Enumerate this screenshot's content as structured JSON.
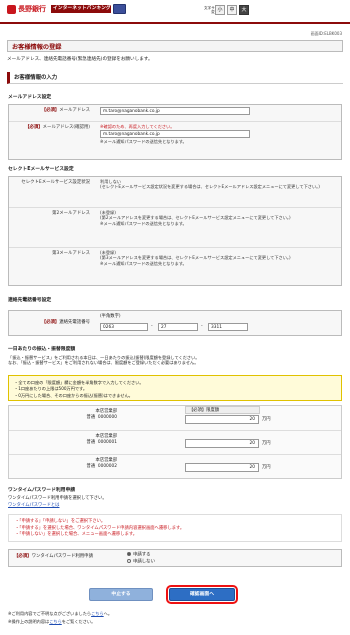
{
  "header": {
    "bank_name": "長野銀行",
    "service_badge": "インターネットバンキング",
    "font_size_label": "文字サイズを\n変更する",
    "font_sizes": [
      "小",
      "中",
      "大"
    ]
  },
  "screen_id": "画面ID:ELBK003",
  "title": "お客様情報の登録",
  "intro": "メールアドレス、連絡先電話番号(緊急連絡先)の登録をお願いします。",
  "section_title": "お客様情報の入力",
  "email_section": {
    "title": "メールアドレス設定",
    "rows": [
      {
        "required": "【必須】",
        "label": "メールアドレス",
        "value": "m.taro@naganobank.co.jp"
      },
      {
        "required": "【必須】",
        "label": "メールアドレス(確認用)",
        "warning": "※確認のため、再度入力してください。",
        "value": "m.taro@naganobank.co.jp",
        "note": "※メール通知パスワードの送信先となります。"
      }
    ]
  },
  "select_section": {
    "title": "セレクトEメールサービス設定",
    "rows": [
      {
        "label": "セレクトEメールサービス設定状況",
        "value": "利用しない",
        "note": "(セレクトEメールサービス設定状況を変更する場合は、セレクトEメールアドレス設定メニューにて変更して下さい。)"
      },
      {
        "label": "第2メールアドレス",
        "value": "(未登録)",
        "note": "(第2メールアドレスを変更する場合は、セレクトEメールサービス設定メニューにて変更して下さい。)",
        "note2": "※メール通知パスワードの送信先となります。"
      },
      {
        "label": "第3メールアドレス",
        "value": "(未登録)",
        "note": "(第3メールアドレスを変更する場合は、セレクトEメールサービス設定メニューにて変更して下さい。)",
        "note2": "※メール通知パスワードの送信先となります。"
      }
    ]
  },
  "phone_section": {
    "title": "連絡先電話番号設定",
    "required": "【必須】",
    "label": "連絡先電話番号",
    "hint": "(半角数字)",
    "parts": [
      "0263",
      "27",
      "3311"
    ],
    "separator": "-"
  },
  "limit_section": {
    "title": "一日あたりの振込・振替限度額",
    "desc1": "「振込・振替サービス」をご利用される本日は、一日あたりの振込(振替)限度額を登録してください。",
    "desc2": "なお、「振込・振替サービス」をご利用されない場合は、限度額をご登録いただく必要はありません。",
    "notices": [
      "・全ての口座の「限度額」欄に金額を半角数字で入力してください。",
      "・1口座あたりの上限は500万円です。",
      "・0万円にした場合、その口座からの振込(振替)はできません。"
    ],
    "limit_label": "【必須】限度額",
    "unit": "万円",
    "accounts": [
      {
        "branch": "本店営業部",
        "type": "普通",
        "number": "0000000",
        "amount": "20"
      },
      {
        "branch": "本店営業部",
        "type": "普通",
        "number": "0000001",
        "amount": "20"
      },
      {
        "branch": "本店営業部",
        "type": "普通",
        "number": "0000002",
        "amount": "20"
      }
    ]
  },
  "otp_section": {
    "title": "ワンタイムパスワード利用申請",
    "desc": "ワンタイムパスワード利用申請を選択して下さい。",
    "link": "ワンタイムパスワードとは",
    "notes": [
      "・「申請する」「申請しない」をご選択下さい。",
      "・「申請する」を選択した場合、ワンタイムパスワード申請内容選択画面へ遷移します。",
      "・「申請しない」を選択した場合、メニュー画面へ遷移します。"
    ],
    "required": "【必須】",
    "label": "ワンタイムパスワード利用申請",
    "options": [
      {
        "label": "申請する",
        "selected": true
      },
      {
        "label": "申請しない",
        "selected": false
      }
    ]
  },
  "buttons": {
    "cancel": "中止する",
    "confirm": "確認画面へ"
  },
  "footer": {
    "line1_pre": "※ご利用内容でご不明な点がございましたら",
    "line1_link": "こちら",
    "line1_post": "へ。",
    "line2_pre": "※操作上の説明内容は",
    "line2_link": "こちら",
    "line2_post": "をご覧ください。"
  }
}
